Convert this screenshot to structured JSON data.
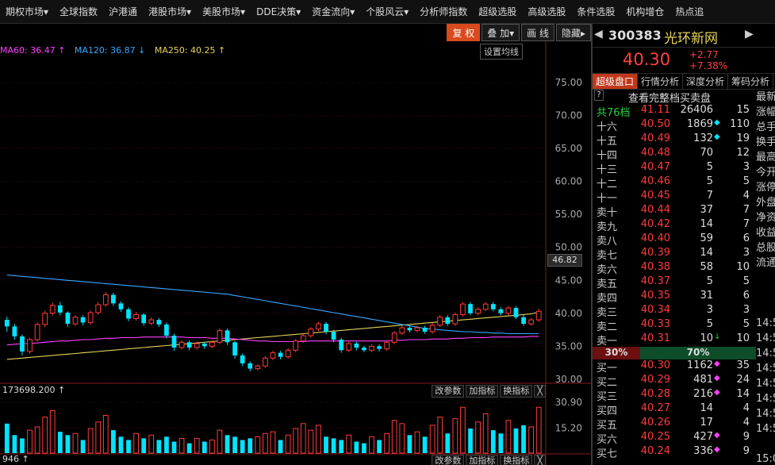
{
  "nav": [
    "期权市场▾",
    "全球指数",
    "沪港通",
    "港股市场▾",
    "美股市场▾",
    "DDE决策▾",
    "资金流向▾",
    "个股风云▾",
    "分析师指数",
    "超级选股",
    "高级选股",
    "条件选股",
    "机构增仓",
    "热点追"
  ],
  "toolbar": {
    "restore": "复 权",
    "overlay": "叠 加▾",
    "draw": "画 线",
    "hide": "隐藏▸"
  },
  "ma_legend": {
    "ma60": "MA60: 36.47 ↑",
    "ma120": "MA120: 36.87 ↓",
    "ma250": "MA250: 40.25 ↑"
  },
  "ma_settings": "设置均线",
  "price_tag": "46.82",
  "vol_label": "173698.200 ↑",
  "vol_label2": "946 ↑",
  "small_buttons": [
    "改参数",
    "加指标",
    "换指标",
    "╳"
  ],
  "colors": {
    "up": "#ff3b3b",
    "down": "#00e5ff",
    "ma60": "#ff40ff",
    "ma120": "#3aa7ff",
    "ma250": "#e6d35a",
    "bg": "#000000"
  },
  "stock": {
    "code": "300383",
    "name": "光环新网",
    "price": "40.30",
    "change": "+2.77",
    "change_pct": "+7.38%"
  },
  "tabs": [
    "超级盘口",
    "行情分析",
    "深度分析",
    "筹码分析"
  ],
  "orderbook": {
    "title": "查看完整档买卖盘",
    "total": {
      "label": "共76档",
      "price": "41.11",
      "vol": "26406",
      "n": "15"
    },
    "asks": [
      {
        "label": "十六",
        "price": "40.50",
        "vol": "1869",
        "mk": "◆",
        "n": "110"
      },
      {
        "label": "十五",
        "price": "40.49",
        "vol": "132",
        "mk": "◆",
        "n": "19"
      },
      {
        "label": "十四",
        "price": "40.48",
        "vol": "70",
        "mk": "",
        "n": "12"
      },
      {
        "label": "十三",
        "price": "40.47",
        "vol": "5",
        "mk": "",
        "n": "3"
      },
      {
        "label": "十二",
        "price": "40.46",
        "vol": "5",
        "mk": "",
        "n": "5"
      },
      {
        "label": "十一",
        "price": "40.45",
        "vol": "7",
        "mk": "",
        "n": "4"
      },
      {
        "label": "卖十",
        "price": "40.44",
        "vol": "37",
        "mk": "",
        "n": "7"
      },
      {
        "label": "卖九",
        "price": "40.42",
        "vol": "14",
        "mk": "",
        "n": "7"
      },
      {
        "label": "卖八",
        "price": "40.40",
        "vol": "59",
        "mk": "",
        "n": "6"
      },
      {
        "label": "卖七",
        "price": "40.39",
        "vol": "14",
        "mk": "",
        "n": "3"
      },
      {
        "label": "卖六",
        "price": "40.38",
        "vol": "58",
        "mk": "",
        "n": "10"
      },
      {
        "label": "卖五",
        "price": "40.37",
        "vol": "5",
        "mk": "",
        "n": "5"
      },
      {
        "label": "卖四",
        "price": "40.35",
        "vol": "31",
        "mk": "",
        "n": "6"
      },
      {
        "label": "卖三",
        "price": "40.34",
        "vol": "3",
        "mk": "",
        "n": "3"
      },
      {
        "label": "卖二",
        "price": "40.33",
        "vol": "5",
        "mk": "",
        "n": "5"
      },
      {
        "label": "卖一",
        "price": "40.31",
        "vol": "10",
        "mk": "↓",
        "n": "10"
      }
    ],
    "split": {
      "ask_pct": "30%",
      "bid_pct": "70%"
    },
    "bids": [
      {
        "label": "买一",
        "price": "40.30",
        "vol": "1162",
        "mk": "◆",
        "n": "35"
      },
      {
        "label": "买二",
        "price": "40.29",
        "vol": "481",
        "mk": "◆",
        "n": "24"
      },
      {
        "label": "买三",
        "price": "40.28",
        "vol": "216",
        "mk": "◆",
        "n": "14"
      },
      {
        "label": "买四",
        "price": "40.27",
        "vol": "14",
        "mk": "",
        "n": "4"
      },
      {
        "label": "买五",
        "price": "40.26",
        "vol": "17",
        "mk": "",
        "n": "4"
      },
      {
        "label": "买六",
        "price": "40.25",
        "vol": "427",
        "mk": "◆",
        "n": "9"
      },
      {
        "label": "买七",
        "price": "40.24",
        "vol": "336",
        "mk": "◆",
        "n": "9"
      }
    ]
  },
  "side_labels": [
    "最新",
    "涨幅",
    "总手",
    "换手",
    "最高",
    "今开",
    "涨停",
    "外盘",
    "净资",
    "收益",
    "总股",
    "流通",
    "",
    "",
    "",
    "14:5",
    "14:5",
    "14:5",
    "14:5",
    "14:5",
    "14:5",
    "14:5",
    "14:5",
    "",
    "15:0"
  ],
  "chart_data": {
    "type": "candlestick",
    "price_axis": {
      "ticks": [
        75,
        70,
        65,
        60,
        55,
        50,
        45,
        40,
        35,
        30
      ],
      "range": [
        29.5,
        78.5
      ]
    },
    "volume_axis": {
      "ticks": [
        30.9,
        15.2
      ]
    },
    "candles": [
      [
        39.0,
        38.0,
        39.5,
        37.2
      ],
      [
        38.0,
        36.5,
        38.4,
        36.0
      ],
      [
        36.5,
        34.2,
        36.8,
        33.6
      ],
      [
        34.2,
        36.0,
        36.3,
        33.9
      ],
      [
        36.0,
        38.3,
        38.6,
        35.7
      ],
      [
        38.3,
        40.0,
        40.4,
        37.9
      ],
      [
        40.0,
        41.2,
        41.6,
        39.6
      ],
      [
        41.2,
        40.1,
        41.7,
        39.7
      ],
      [
        40.1,
        38.4,
        40.3,
        37.9
      ],
      [
        38.4,
        39.4,
        39.7,
        38.1
      ],
      [
        39.4,
        38.6,
        39.7,
        38.2
      ],
      [
        38.6,
        40.1,
        40.4,
        38.3
      ],
      [
        40.1,
        41.3,
        41.7,
        39.8
      ],
      [
        41.3,
        42.8,
        43.2,
        41.0
      ],
      [
        42.8,
        41.5,
        43.1,
        41.1
      ],
      [
        41.5,
        40.6,
        41.8,
        40.2
      ],
      [
        40.6,
        39.2,
        40.9,
        38.8
      ],
      [
        39.2,
        39.8,
        40.2,
        38.9
      ],
      [
        39.8,
        38.5,
        40.0,
        38.1
      ],
      [
        38.5,
        39.0,
        39.4,
        38.2
      ],
      [
        39.0,
        38.3,
        39.3,
        37.9
      ],
      [
        38.3,
        36.6,
        38.6,
        36.2
      ],
      [
        36.6,
        34.8,
        36.9,
        34.3
      ],
      [
        34.8,
        35.6,
        35.9,
        34.5
      ],
      [
        35.6,
        34.8,
        35.9,
        34.4
      ],
      [
        34.8,
        35.4,
        35.7,
        34.5
      ],
      [
        35.4,
        35.0,
        35.7,
        34.6
      ],
      [
        35.0,
        35.6,
        35.9,
        34.7
      ],
      [
        35.6,
        37.4,
        37.7,
        35.3
      ],
      [
        37.4,
        35.6,
        37.7,
        35.2
      ],
      [
        35.6,
        33.6,
        35.8,
        33.1
      ],
      [
        33.6,
        32.4,
        33.9,
        32.0
      ],
      [
        32.4,
        31.6,
        32.7,
        31.2
      ],
      [
        31.6,
        32.0,
        32.3,
        31.3
      ],
      [
        32.0,
        33.2,
        33.5,
        31.7
      ],
      [
        33.2,
        34.0,
        34.3,
        32.9
      ],
      [
        34.0,
        33.4,
        34.3,
        33.0
      ],
      [
        33.4,
        34.4,
        34.7,
        33.1
      ],
      [
        34.4,
        35.8,
        36.1,
        34.1
      ],
      [
        35.8,
        36.6,
        36.9,
        35.5
      ],
      [
        36.6,
        37.6,
        37.9,
        36.3
      ],
      [
        37.6,
        38.4,
        38.7,
        37.3
      ],
      [
        38.4,
        37.2,
        38.7,
        36.8
      ],
      [
        37.2,
        36.0,
        37.5,
        35.6
      ],
      [
        36.0,
        34.4,
        36.3,
        34.0
      ],
      [
        34.4,
        35.4,
        35.7,
        34.1
      ],
      [
        35.4,
        34.8,
        35.7,
        34.4
      ],
      [
        34.8,
        34.4,
        35.1,
        34.1
      ],
      [
        34.4,
        35.0,
        35.3,
        34.1
      ],
      [
        35.0,
        34.6,
        35.3,
        34.2
      ],
      [
        34.6,
        35.6,
        35.9,
        34.3
      ],
      [
        35.6,
        37.0,
        37.3,
        35.3
      ],
      [
        37.0,
        37.8,
        38.1,
        36.7
      ],
      [
        37.8,
        37.4,
        38.1,
        37.1
      ],
      [
        37.4,
        37.8,
        38.1,
        37.1
      ],
      [
        37.8,
        37.2,
        38.1,
        36.9
      ],
      [
        37.2,
        38.2,
        38.5,
        36.9
      ],
      [
        38.2,
        39.4,
        39.7,
        37.9
      ],
      [
        39.4,
        38.4,
        39.7,
        38.1
      ],
      [
        38.4,
        39.8,
        40.1,
        38.1
      ],
      [
        39.8,
        41.4,
        41.7,
        39.5
      ],
      [
        41.4,
        40.0,
        41.7,
        39.7
      ],
      [
        40.0,
        40.6,
        40.9,
        39.7
      ],
      [
        40.6,
        41.4,
        41.7,
        40.3
      ],
      [
        41.4,
        40.6,
        41.7,
        40.3
      ],
      [
        40.6,
        40.0,
        40.9,
        39.7
      ],
      [
        40.0,
        40.8,
        41.1,
        39.7
      ],
      [
        40.8,
        39.4,
        41.1,
        39.1
      ],
      [
        39.4,
        38.4,
        39.7,
        38.1
      ],
      [
        38.4,
        39.0,
        39.3,
        38.1
      ],
      [
        39.0,
        40.3,
        40.7,
        38.7
      ]
    ],
    "volumes": [
      18,
      11,
      9,
      14,
      16,
      22,
      26,
      13,
      11,
      12,
      8,
      15,
      19,
      23,
      14,
      10,
      8,
      12,
      9,
      11,
      8,
      10,
      7,
      9,
      6,
      9,
      7,
      8,
      14,
      11,
      10,
      8,
      9,
      10,
      12,
      13,
      8,
      11,
      15,
      18,
      14,
      17,
      10,
      9,
      8,
      11,
      7,
      6,
      10,
      8,
      12,
      20,
      18,
      11,
      13,
      10,
      17,
      22,
      12,
      21,
      28,
      15,
      19,
      24,
      14,
      12,
      20,
      15,
      17,
      16,
      28
    ],
    "ma60": [
      35.2,
      35.3,
      35.4,
      35.4,
      35.5,
      35.6,
      35.7,
      35.8,
      35.8,
      35.9,
      36.0,
      36.0,
      36.1,
      36.2,
      36.2,
      36.3,
      36.3,
      36.3,
      36.4,
      36.4,
      36.4,
      36.4,
      36.4,
      36.4,
      36.3,
      36.3,
      36.3,
      36.2,
      36.2,
      36.2,
      36.1,
      36.0,
      35.9,
      35.8,
      35.8,
      35.7,
      35.7,
      35.7,
      35.7,
      35.7,
      35.8,
      35.8,
      35.8,
      35.8,
      35.8,
      35.8,
      35.8,
      35.8,
      35.8,
      35.8,
      35.8,
      35.9,
      35.9,
      36.0,
      36.0,
      36.0,
      36.1,
      36.1,
      36.1,
      36.2,
      36.2,
      36.3,
      36.3,
      36.3,
      36.4,
      36.4,
      36.4,
      36.4,
      36.4,
      36.5,
      36.5
    ],
    "ma120": [
      45.8,
      45.7,
      45.6,
      45.5,
      45.4,
      45.3,
      45.2,
      45.1,
      45.0,
      44.9,
      44.8,
      44.7,
      44.6,
      44.5,
      44.4,
      44.3,
      44.2,
      44.1,
      44.0,
      43.9,
      43.8,
      43.7,
      43.6,
      43.5,
      43.4,
      43.3,
      43.2,
      43.1,
      43.0,
      42.9,
      42.7,
      42.5,
      42.3,
      42.1,
      41.9,
      41.7,
      41.5,
      41.3,
      41.1,
      40.9,
      40.7,
      40.5,
      40.3,
      40.1,
      39.9,
      39.7,
      39.5,
      39.3,
      39.1,
      38.9,
      38.7,
      38.5,
      38.3,
      38.1,
      37.9,
      37.7,
      37.6,
      37.5,
      37.4,
      37.3,
      37.2,
      37.2,
      37.1,
      37.1,
      37.0,
      37.0,
      36.9,
      36.9,
      36.9,
      36.9,
      36.9
    ],
    "ma250": [
      33.0,
      33.1,
      33.2,
      33.3,
      33.4,
      33.5,
      33.6,
      33.7,
      33.8,
      33.9,
      34.0,
      34.1,
      34.2,
      34.3,
      34.4,
      34.5,
      34.6,
      34.7,
      34.8,
      34.9,
      35.0,
      35.1,
      35.2,
      35.3,
      35.4,
      35.5,
      35.6,
      35.7,
      35.8,
      35.9,
      36.0,
      36.1,
      36.2,
      36.3,
      36.4,
      36.5,
      36.6,
      36.7,
      36.8,
      36.9,
      37.0,
      37.1,
      37.2,
      37.3,
      37.4,
      37.5,
      37.6,
      37.7,
      37.8,
      37.9,
      38.0,
      38.1,
      38.2,
      38.3,
      38.4,
      38.5,
      38.6,
      38.7,
      38.8,
      38.9,
      39.0,
      39.1,
      39.2,
      39.3,
      39.4,
      39.5,
      39.6,
      39.7,
      39.8,
      39.9,
      40.2
    ]
  }
}
